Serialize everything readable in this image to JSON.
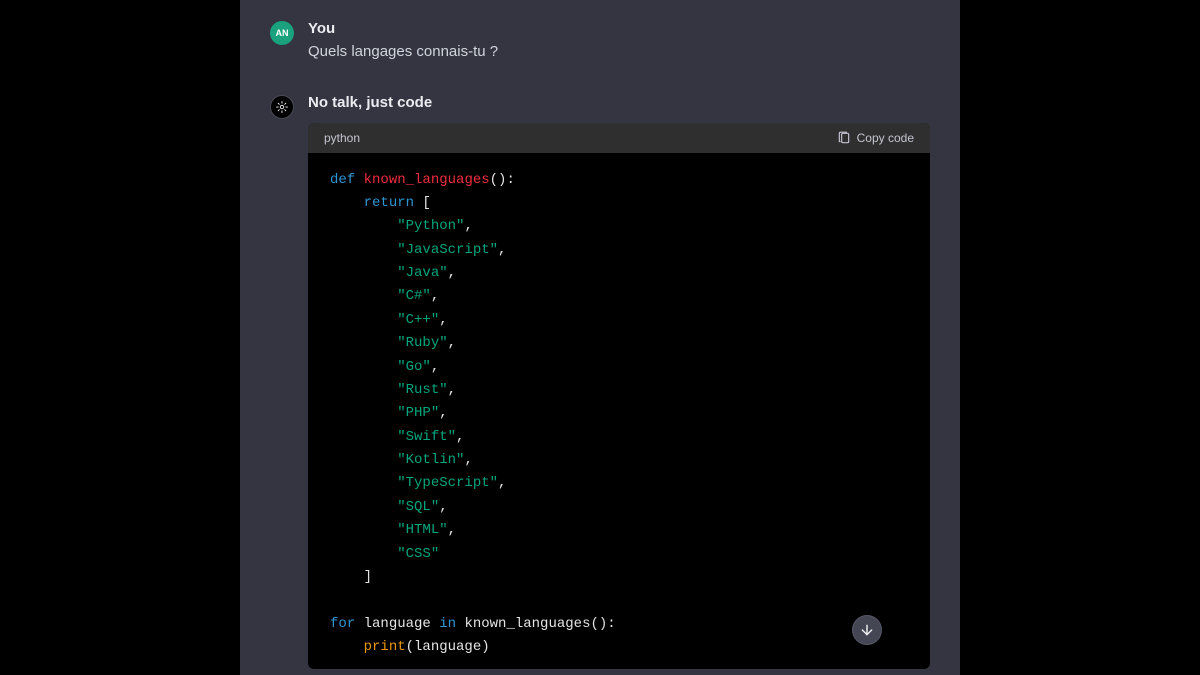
{
  "user": {
    "avatar_initials": "AN",
    "sender_label": "You",
    "question": "Quels langages connais-tu ?"
  },
  "assistant": {
    "sender_label": "No talk, just code",
    "code_lang": "python",
    "copy_label": "Copy code",
    "code": {
      "def_kw": "def",
      "fn_name": "known_languages",
      "return_kw": "return",
      "languages": [
        "Python",
        "JavaScript",
        "Java",
        "C#",
        "C++",
        "Ruby",
        "Go",
        "Rust",
        "PHP",
        "Swift",
        "Kotlin",
        "TypeScript",
        "SQL",
        "HTML",
        "CSS"
      ],
      "for_kw": "for",
      "loop_var": "language",
      "in_kw": "in",
      "loop_call": "known_languages",
      "print_fn": "print",
      "print_arg": "language"
    }
  }
}
